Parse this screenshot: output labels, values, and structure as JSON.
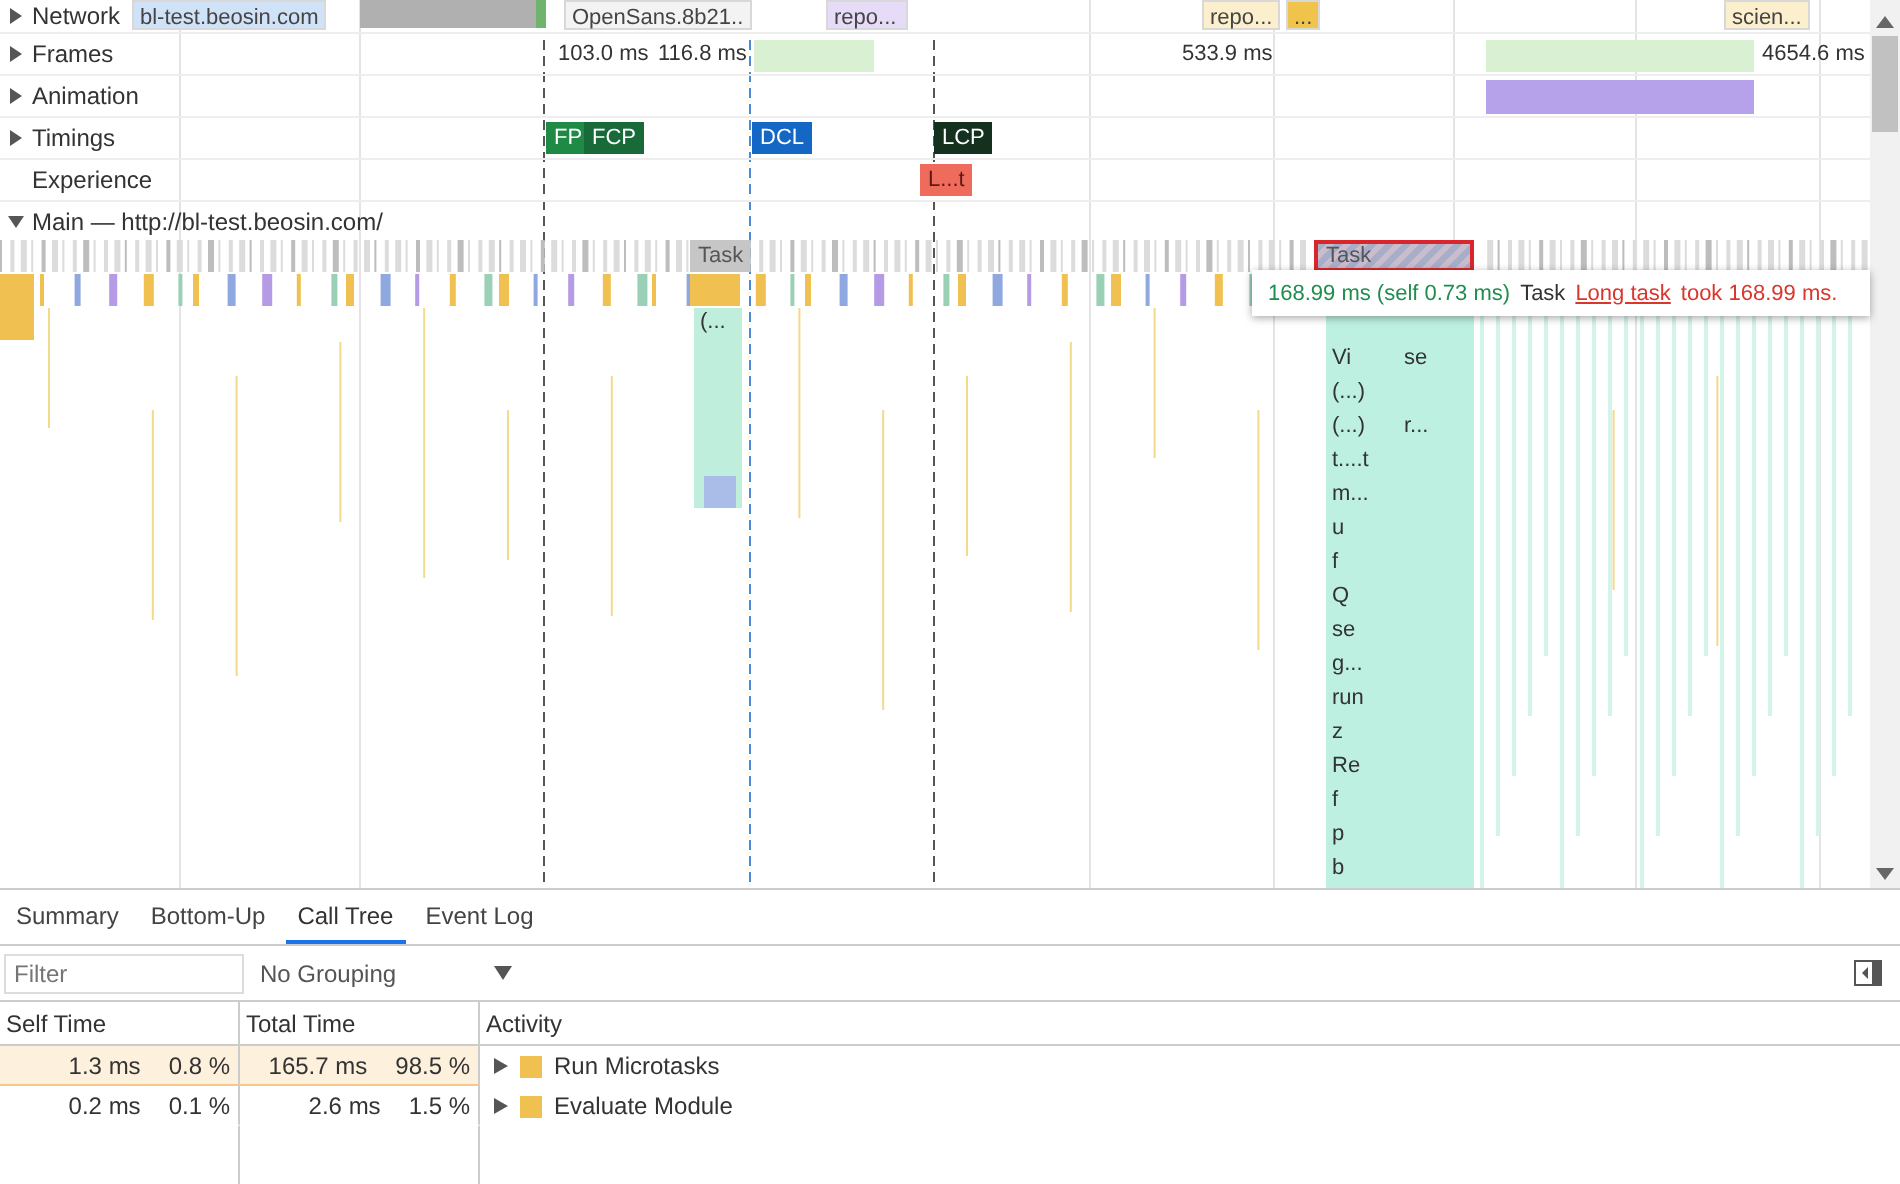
{
  "tracks": [
    {
      "label": "Network",
      "kind": "collapsed"
    },
    {
      "label": "Frames",
      "kind": "collapsed"
    },
    {
      "label": "Animation",
      "kind": "collapsed"
    },
    {
      "label": "Timings",
      "kind": "collapsed"
    },
    {
      "label": "Experience",
      "kind": "plain"
    },
    {
      "label": "Main — http://bl-test.beosin.com/",
      "kind": "expanded"
    }
  ],
  "network_requests": [
    {
      "label": "bl-test.beosin.com",
      "color": "#cfe2f7"
    },
    {
      "label": "OpenSans.8b21..",
      "color": "#f3f3f3"
    },
    {
      "label": "repo...",
      "color": "#e6dcf7"
    },
    {
      "label": "repo...",
      "color": "#fbefcd"
    },
    {
      "label": "...",
      "color": "#f0c34c"
    },
    {
      "label": "scien...",
      "color": "#fbefcd"
    }
  ],
  "frame_times": [
    "103.0 ms",
    "116.8 ms",
    "533.9 ms",
    "4654.6 ms"
  ],
  "timings": [
    {
      "label": "FP",
      "color": "#1f8a46"
    },
    {
      "label": "FCP",
      "color": "#186b39"
    },
    {
      "label": "DCL",
      "color": "#1567c6"
    },
    {
      "label": "LCP",
      "color": "#13311e"
    }
  ],
  "experience": [
    {
      "label": "L...t",
      "color": "#ef6b5c"
    }
  ],
  "flame": {
    "tasks": [
      {
        "label": "Task",
        "selected": false
      },
      {
        "label": "Task",
        "selected": true
      }
    ],
    "sub_label": "(...",
    "stack": [
      {
        "label": "Vi",
        "label_2": "se"
      },
      {
        "label": "(...)"
      },
      {
        "label": "(...)",
        "label_2": "r..."
      },
      {
        "label": "t....t"
      },
      {
        "label": "m..."
      },
      {
        "label": "u"
      },
      {
        "label": "f"
      },
      {
        "label": "Q"
      },
      {
        "label": "se"
      },
      {
        "label": "g..."
      },
      {
        "label": "run"
      },
      {
        "label": "z"
      },
      {
        "label": "Re"
      },
      {
        "label": "f"
      },
      {
        "label": "p"
      },
      {
        "label": "b"
      }
    ]
  },
  "tooltip": {
    "duration": "168.99 ms (self 0.73 ms)",
    "name": "Task",
    "link": "Long task",
    "message": "took 168.99 ms."
  },
  "tabs": [
    {
      "label": "Summary",
      "selected": false
    },
    {
      "label": "Bottom-Up",
      "selected": false
    },
    {
      "label": "Call Tree",
      "selected": true
    },
    {
      "label": "Event Log",
      "selected": false
    }
  ],
  "filter": {
    "placeholder": "Filter"
  },
  "grouping": "No Grouping",
  "columns": [
    "Self Time",
    "Total Time",
    "Activity"
  ],
  "rows": [
    {
      "self_time": "1.3 ms",
      "self_pct": "0.8 %",
      "total_time": "165.7 ms",
      "total_pct": "98.5 %",
      "activity": "Run Microtasks",
      "color": "#f0c050",
      "selected": true
    },
    {
      "self_time": "0.2 ms",
      "self_pct": "0.1 %",
      "total_time": "2.6 ms",
      "total_pct": "1.5 %",
      "activity": "Evaluate Module",
      "color": "#f0c050",
      "selected": false
    }
  ]
}
